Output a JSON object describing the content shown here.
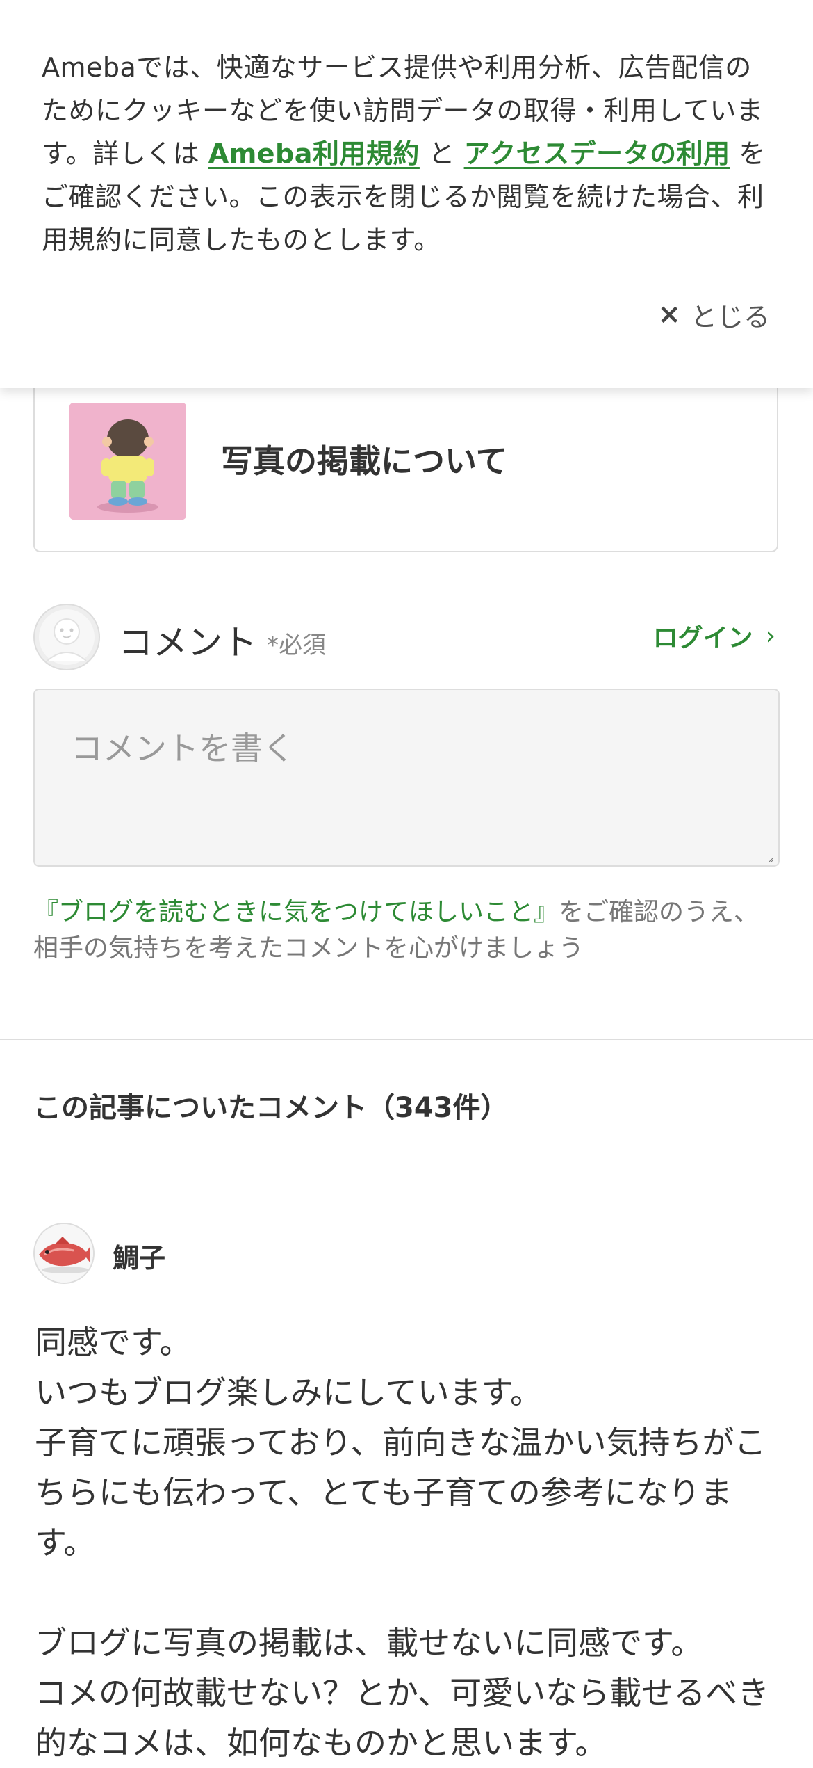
{
  "cookie_banner": {
    "text_before": "Amebaでは、快適なサービス提供や利用分析、広告配信のためにクッキーなどを使い訪問データの取得・利用しています。詳しくは ",
    "link_terms": "Ameba利用規約",
    "text_and": " と ",
    "link_access": "アクセスデータの利用",
    "text_after": " をご確認ください。この表示を閉じるか閲覧を続けた場合、利用規約に同意したものとします。",
    "close_icon": "×",
    "close_label": "とじる"
  },
  "article_card": {
    "title": "写真の掲載について"
  },
  "comment_form": {
    "label": "コメント",
    "required": "*必須",
    "login_label": "ログイン",
    "login_chevron": "›",
    "placeholder": "コメントを書く",
    "notice_link": "『ブログを読むときに気をつけてほしいこと』",
    "notice_text": "をご確認のうえ、相手の気持ちを考えたコメントを心がけましょう"
  },
  "comments_section": {
    "heading": "この記事についたコメント（343件）"
  },
  "comments": [
    {
      "user": "鯛子",
      "lines_1": [
        "同感です。",
        "いつもブログ楽しみにしています。",
        "子育てに頑張っており、前向きな温かい気持ちがこちらにも伝わって、とても子育ての参考になります。"
      ],
      "lines_2": [
        "ブログに写真の掲載は、載せないに同感です。",
        "コメの何故載せない？とか、可愛いなら載せるべき的なコメは、如何なものかと思います。"
      ]
    }
  ],
  "colors": {
    "accent_green": "#2d8a34",
    "thumb_pink": "#f0b3cc"
  }
}
